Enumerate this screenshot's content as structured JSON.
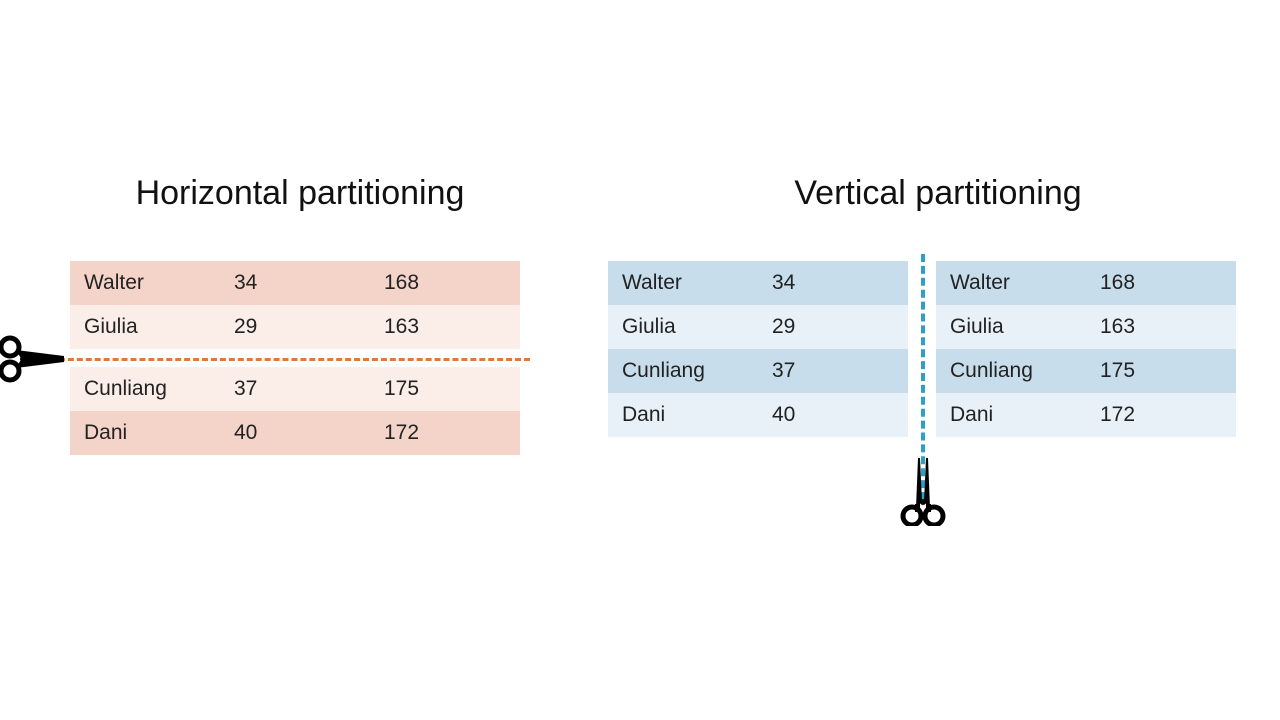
{
  "horizontal": {
    "title": "Horizontal partitioning",
    "rows": [
      {
        "name": "Walter",
        "age": "34",
        "val": "168"
      },
      {
        "name": "Giulia",
        "age": "29",
        "val": "163"
      },
      {
        "name": "Cunliang",
        "age": "37",
        "val": "175"
      },
      {
        "name": "Dani",
        "age": "40",
        "val": "172"
      }
    ]
  },
  "vertical": {
    "title": "Vertical partitioning",
    "left": [
      {
        "name": "Walter",
        "v": "34"
      },
      {
        "name": "Giulia",
        "v": "29"
      },
      {
        "name": "Cunliang",
        "v": "37"
      },
      {
        "name": "Dani",
        "v": "40"
      }
    ],
    "right": [
      {
        "name": "Walter",
        "v": "168"
      },
      {
        "name": "Giulia",
        "v": "163"
      },
      {
        "name": "Cunliang",
        "v": "175"
      },
      {
        "name": "Dani",
        "v": "172"
      }
    ]
  },
  "colors": {
    "h_dash": "#d97a3f",
    "v_dash": "#2ea0c8",
    "h_row_dark": "#f4d4c9",
    "h_row_light": "#fbeee9",
    "v_row_dark": "#c8ddeb",
    "v_row_light": "#e8f1f8"
  }
}
